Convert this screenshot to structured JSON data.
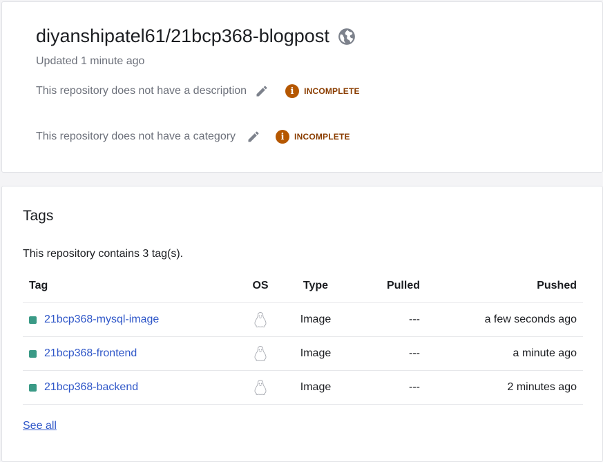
{
  "repo": {
    "title": "diyanshipatel61/21bcp368-blogpost",
    "updated": "Updated 1 minute ago",
    "description_text": "This repository does not have a description",
    "category_text": "This repository does not have a category",
    "badge_label": "INCOMPLETE",
    "badge_icon_glyph": "i",
    "visibility_icon": "globe-icon"
  },
  "tags": {
    "title": "Tags",
    "count_text": "This repository contains 3 tag(s).",
    "columns": [
      "Tag",
      "OS",
      "Type",
      "Pulled",
      "Pushed"
    ],
    "rows": [
      {
        "tag": "21bcp368-mysql-image",
        "os_icon": "linux-icon",
        "type": "Image",
        "pulled": "---",
        "pushed": "a few seconds ago"
      },
      {
        "tag": "21bcp368-frontend",
        "os_icon": "linux-icon",
        "type": "Image",
        "pulled": "---",
        "pushed": "a minute ago"
      },
      {
        "tag": "21bcp368-backend",
        "os_icon": "linux-icon",
        "type": "Image",
        "pulled": "---",
        "pushed": "2 minutes ago"
      }
    ],
    "see_all": "See all"
  },
  "colors": {
    "link": "#2e56c8",
    "badge": "#b55700",
    "status_dot": "#3a9a86"
  }
}
